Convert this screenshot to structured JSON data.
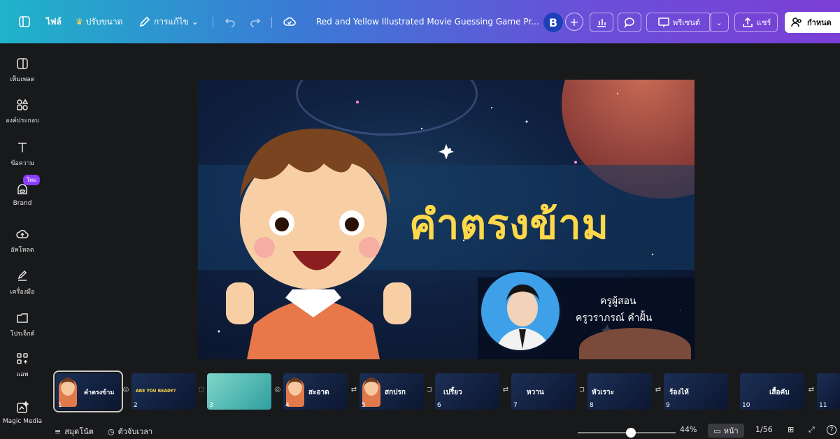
{
  "toolbar": {
    "menu_file": "ไฟล์",
    "resize": "ปรับขนาด",
    "edit": "การแก้ไข",
    "doc_title": "Red and Yellow Illustrated Movie Guessing Game Pr...",
    "avatar_initial": "B",
    "plus": "+",
    "present": "พรีเซนต์",
    "share": "แชร์",
    "setup": "กำหนด"
  },
  "sidebar": {
    "items": [
      {
        "label": "เท็มเพลต",
        "icon": "template-icon"
      },
      {
        "label": "องค์ประกอบ",
        "icon": "elements-icon"
      },
      {
        "label": "ข้อความ",
        "icon": "text-icon"
      },
      {
        "label": "Brand",
        "icon": "brand-icon"
      },
      {
        "label": "อัพโหลด",
        "icon": "upload-icon"
      },
      {
        "label": "เครื่องมือ",
        "icon": "draw-icon"
      },
      {
        "label": "โปรเจ็กต์",
        "icon": "folder-icon"
      },
      {
        "label": "แอพ",
        "icon": "apps-icon"
      },
      {
        "label": "Magic Media",
        "icon": "magic-media-icon"
      }
    ],
    "new_badge": "ใหม่"
  },
  "slide": {
    "title": "คำตรงข้าม",
    "teacher_label": "ครูผู้สอน",
    "teacher_name": "ครูวราภรณ์  คำฝั้น"
  },
  "filmstrip": [
    {
      "num": "1",
      "label": "คำตรงข้าม"
    },
    {
      "num": "2",
      "label": "ARE YOU READY?"
    },
    {
      "num": "3",
      "label": ""
    },
    {
      "num": "4",
      "label": "สะอาด"
    },
    {
      "num": "5",
      "label": "สกปรก"
    },
    {
      "num": "6",
      "label": "เปรี้ยว"
    },
    {
      "num": "7",
      "label": "หวาน"
    },
    {
      "num": "8",
      "label": "หัวเราะ"
    },
    {
      "num": "9",
      "label": "ร้องไห้"
    },
    {
      "num": "10",
      "label": "เสื้อคับ"
    },
    {
      "num": "11",
      "label": ""
    }
  ],
  "bottombar": {
    "notes": "สมุดโน้ต",
    "timer": "ตัวจับเวลา",
    "zoom": "44%",
    "zoom_value": 44,
    "page_view": "หน้า",
    "page_count": "1/56",
    "help": "?"
  }
}
